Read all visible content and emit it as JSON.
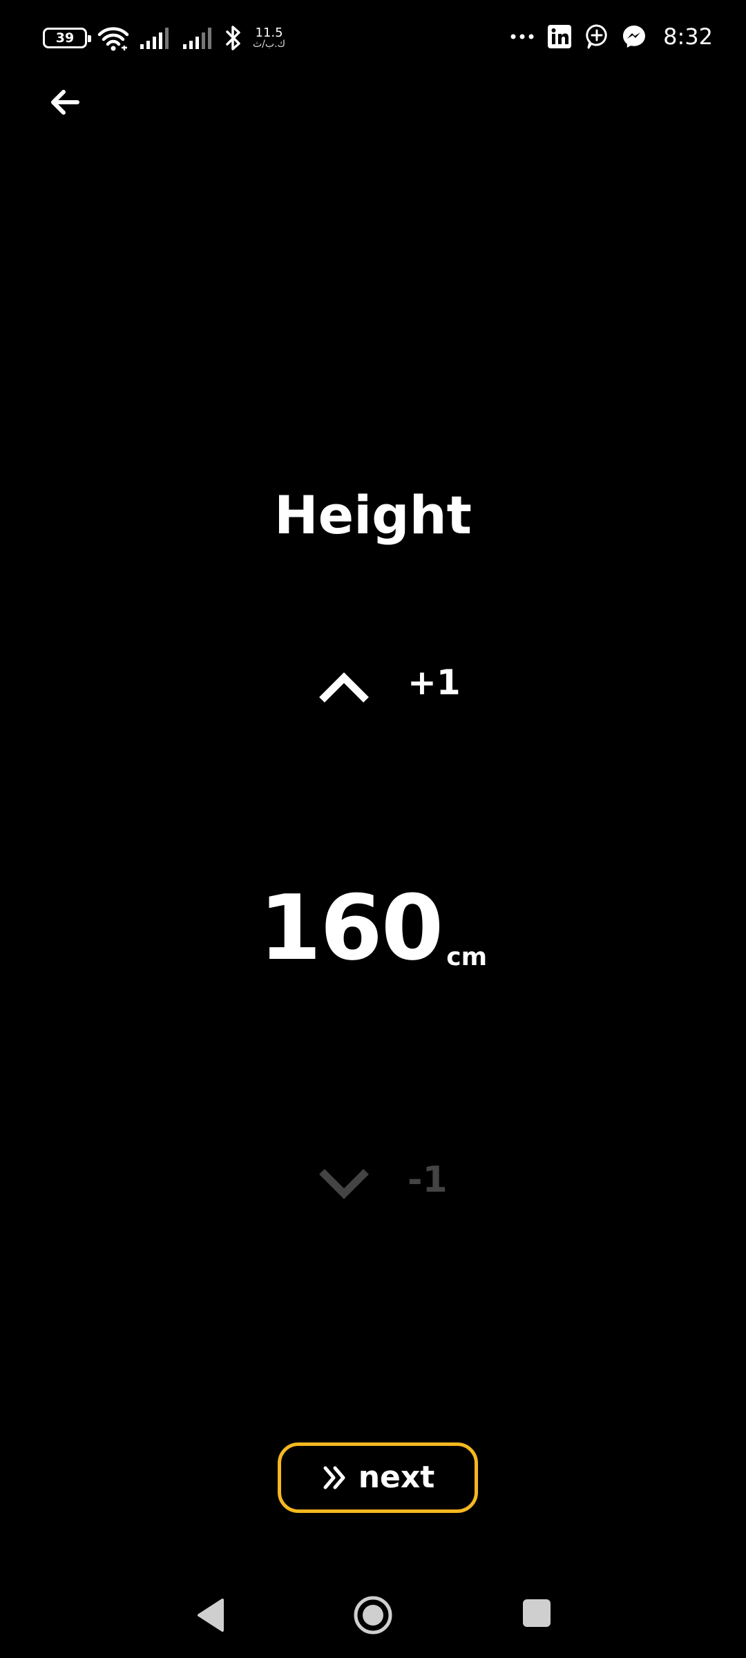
{
  "status_bar": {
    "battery_level": "39",
    "net_speed_value": "11.5",
    "net_speed_unit": "ك.ب/ث",
    "overflow": "···",
    "time": "8:32"
  },
  "screen": {
    "title": "Height",
    "increment_label": "+1",
    "value": "160",
    "unit": "cm",
    "decrement_label": "-1"
  },
  "actions": {
    "next_label": "next"
  },
  "colors": {
    "background": "#000000",
    "accent": "#f5b820",
    "text": "#ffffff",
    "disabled": "#444444"
  },
  "icons": {
    "back": "arrow-left-icon",
    "increment": "chevron-up-icon",
    "decrement": "chevron-down-icon",
    "next": "double-chevron-right-icon"
  }
}
